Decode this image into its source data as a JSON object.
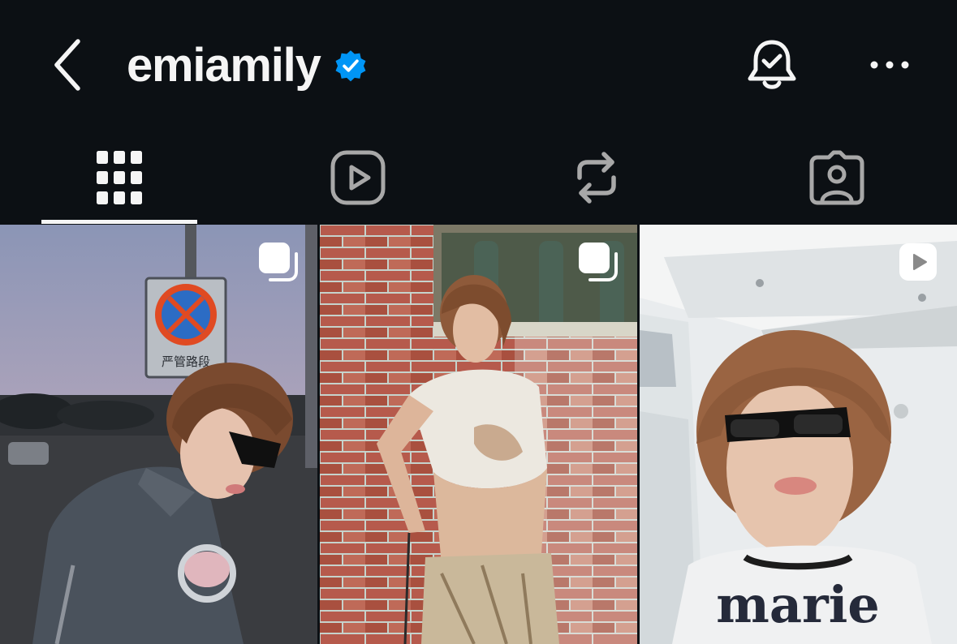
{
  "header": {
    "username": "emiamily",
    "verified": true,
    "back_icon": "chevron-left-icon",
    "bell_icon": "bell-check-icon",
    "more_icon": "more-horizontal-icon"
  },
  "tabs": [
    {
      "icon": "grid-icon",
      "selected": true
    },
    {
      "icon": "reels-icon",
      "selected": false
    },
    {
      "icon": "reposts-icon",
      "selected": false
    },
    {
      "icon": "tagged-icon",
      "selected": false
    }
  ],
  "posts": [
    {
      "type": "carousel",
      "badge_icon": "carousel-icon",
      "sign_text": "严管路段"
    },
    {
      "type": "carousel",
      "badge_icon": "carousel-icon"
    },
    {
      "type": "reel",
      "badge_icon": "reel-icon",
      "shirt_text": "marie"
    }
  ],
  "colors": {
    "background": "#0c1014",
    "text": "#f5f5f5",
    "icon_inactive": "#a8a8a8",
    "verified_blue": "#0095f6"
  }
}
